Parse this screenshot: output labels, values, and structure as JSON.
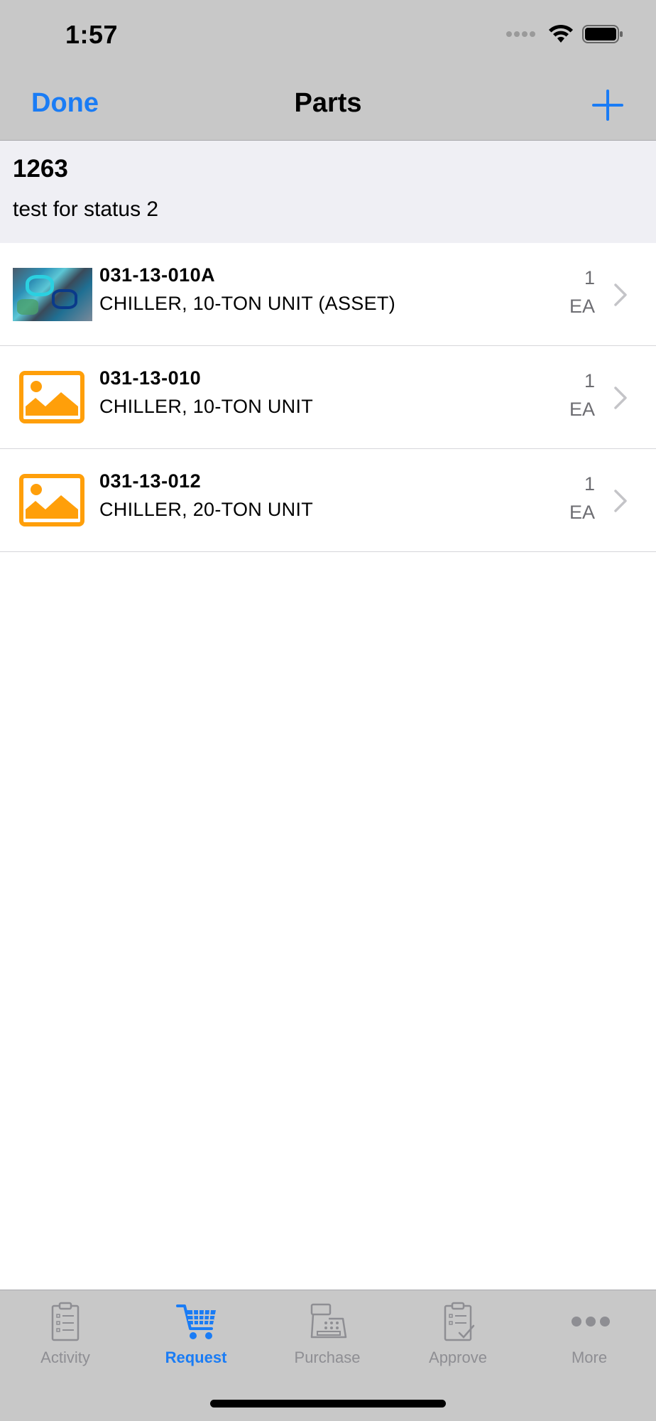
{
  "status_bar": {
    "time": "1:57"
  },
  "nav": {
    "done_label": "Done",
    "title": "Parts"
  },
  "header": {
    "id": "1263",
    "description": "test for status 2"
  },
  "parts": [
    {
      "number": "031-13-010A",
      "description": "CHILLER, 10-TON UNIT (ASSET)",
      "qty": "1",
      "uom": "EA",
      "thumbnail": "photo"
    },
    {
      "number": "031-13-010",
      "description": "CHILLER, 10-TON UNIT",
      "qty": "1",
      "uom": "EA",
      "thumbnail": "image-placeholder-icon"
    },
    {
      "number": "031-13-012",
      "description": "CHILLER, 20-TON UNIT",
      "qty": "1",
      "uom": "EA",
      "thumbnail": "image-placeholder-icon"
    }
  ],
  "tabs": [
    {
      "label": "Activity",
      "icon": "clipboard-list-icon"
    },
    {
      "label": "Request",
      "icon": "shopping-cart-icon",
      "active": true
    },
    {
      "label": "Purchase",
      "icon": "cash-register-icon"
    },
    {
      "label": "Approve",
      "icon": "clipboard-check-icon"
    },
    {
      "label": "More",
      "icon": "more-dots-icon"
    }
  ],
  "colors": {
    "accent": "#1a7cf5",
    "placeholder_icon": "#ff9f0a",
    "bar_bg": "#c8c8c8",
    "header_bg": "#efeff4",
    "inactive_tab": "#8e8e93"
  }
}
